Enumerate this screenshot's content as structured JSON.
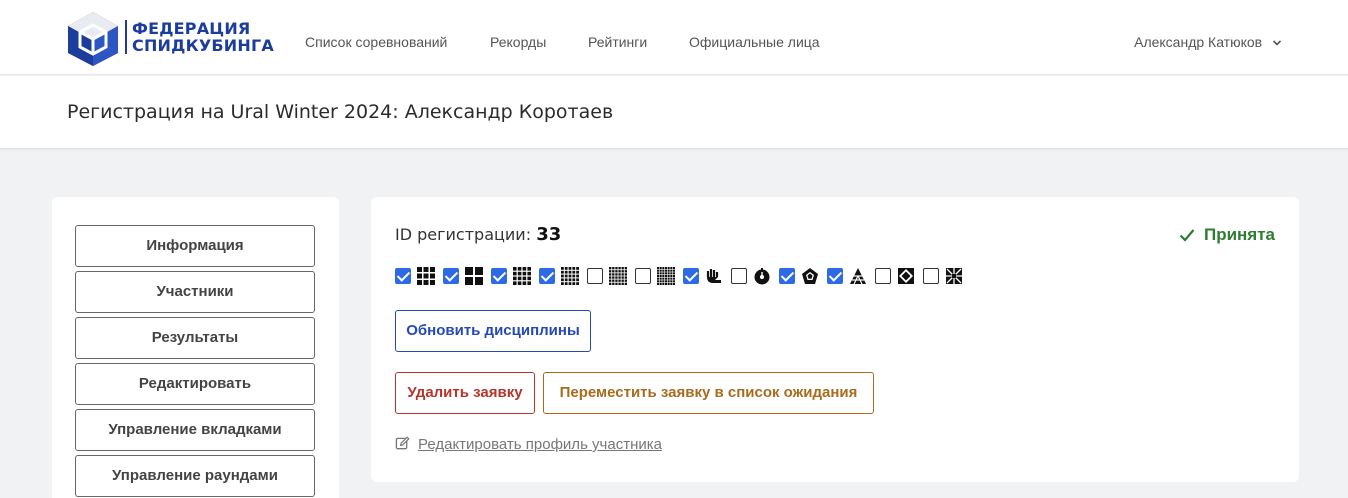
{
  "brand": {
    "line1": "ФЕДЕРАЦИЯ",
    "line2": "СПИДКУБИНГА",
    "colors": {
      "blue": "#1c3d9c",
      "red": "#d2232a",
      "white": "#ffffff"
    }
  },
  "nav": {
    "items": [
      {
        "label": "Список соревнований"
      },
      {
        "label": "Рекорды"
      },
      {
        "label": "Рейтинги"
      },
      {
        "label": "Официальные лица"
      }
    ],
    "user": {
      "name": "Александр Катюков",
      "icon": "chevron-down-icon"
    }
  },
  "header": {
    "title": "Регистрация на Ural Winter 2024: Александр Коротаев"
  },
  "sidebar": {
    "items": [
      {
        "label": "Информация"
      },
      {
        "label": "Участники"
      },
      {
        "label": "Результаты"
      },
      {
        "label": "Редактировать"
      },
      {
        "label": "Управление вкладками"
      },
      {
        "label": "Управление раундами"
      }
    ]
  },
  "registration": {
    "id_label": "ID регистрации:",
    "id_value": "33",
    "status": {
      "label": "Принята",
      "icon": "check-icon",
      "color": "#2e7d32"
    },
    "events": [
      {
        "icon": "cube-3x3-icon",
        "checked": true
      },
      {
        "icon": "cube-2x2-icon",
        "checked": true
      },
      {
        "icon": "cube-4x4-icon",
        "checked": true
      },
      {
        "icon": "cube-5x5-icon",
        "checked": true
      },
      {
        "icon": "cube-6x6-icon",
        "checked": false
      },
      {
        "icon": "cube-7x7-icon",
        "checked": false
      },
      {
        "icon": "one-handed-icon",
        "checked": true
      },
      {
        "icon": "clock-icon",
        "checked": false
      },
      {
        "icon": "megaminx-icon",
        "checked": true
      },
      {
        "icon": "pyraminx-icon",
        "checked": true
      },
      {
        "icon": "skewb-icon",
        "checked": false
      },
      {
        "icon": "square-1-icon",
        "checked": false
      }
    ],
    "update_button": "Обновить дисциплины",
    "delete_button": "Удалить заявку",
    "waitlist_button": "Переместить заявку в список ожидания",
    "edit_profile_link": "Редактировать профиль участника",
    "colors": {
      "primary": "#2549b8",
      "danger": "#b5352d",
      "warning": "#a86c1c",
      "checkbox": "#2d6be4"
    }
  }
}
